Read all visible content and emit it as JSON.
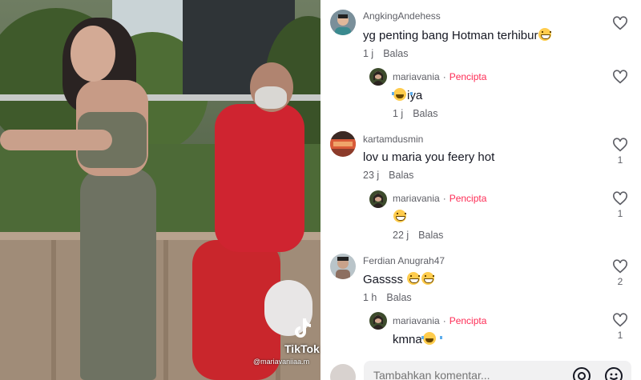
{
  "video": {
    "watermark_brand": "TikTok",
    "watermark_handle": "@mariavaniiaa.m"
  },
  "comments": [
    {
      "user": "AngkingAndehess",
      "text": "yg penting bang Hotman terhibur",
      "emojis": [
        "grin"
      ],
      "time": "1 j",
      "reply_label": "Balas",
      "likes": "",
      "is_reply": false
    },
    {
      "user": "mariavania",
      "creator_label": "Pencipta",
      "text": "iya",
      "emojis_before": [
        "joy"
      ],
      "time": "1 j",
      "reply_label": "Balas",
      "likes": "",
      "is_reply": true
    },
    {
      "user": "kartamdusmin",
      "text": "lov u maria you feery hot",
      "time": "23 j",
      "reply_label": "Balas",
      "likes": "1",
      "is_reply": false
    },
    {
      "user": "mariavania",
      "creator_label": "Pencipta",
      "text": "",
      "emojis": [
        "grin"
      ],
      "time": "22 j",
      "reply_label": "Balas",
      "likes": "1",
      "is_reply": true
    },
    {
      "user": "Ferdian Anugrah47",
      "text": "Gassss",
      "emojis": [
        "grin",
        "grin"
      ],
      "time": "1 h",
      "reply_label": "Balas",
      "likes": "2",
      "is_reply": false
    },
    {
      "user": "mariavania",
      "creator_label": "Pencipta",
      "text": "kmna",
      "emojis": [
        "joy"
      ],
      "time": "",
      "reply_label": "",
      "likes": "1",
      "is_reply": true
    }
  ],
  "input": {
    "placeholder": "Tambahkan komentar..."
  },
  "icons": [
    "heart-icon",
    "mention-icon",
    "emoji-icon"
  ],
  "colors": {
    "creator": "#fe2c55",
    "text": "#161823",
    "muted": "#5e5f66"
  }
}
